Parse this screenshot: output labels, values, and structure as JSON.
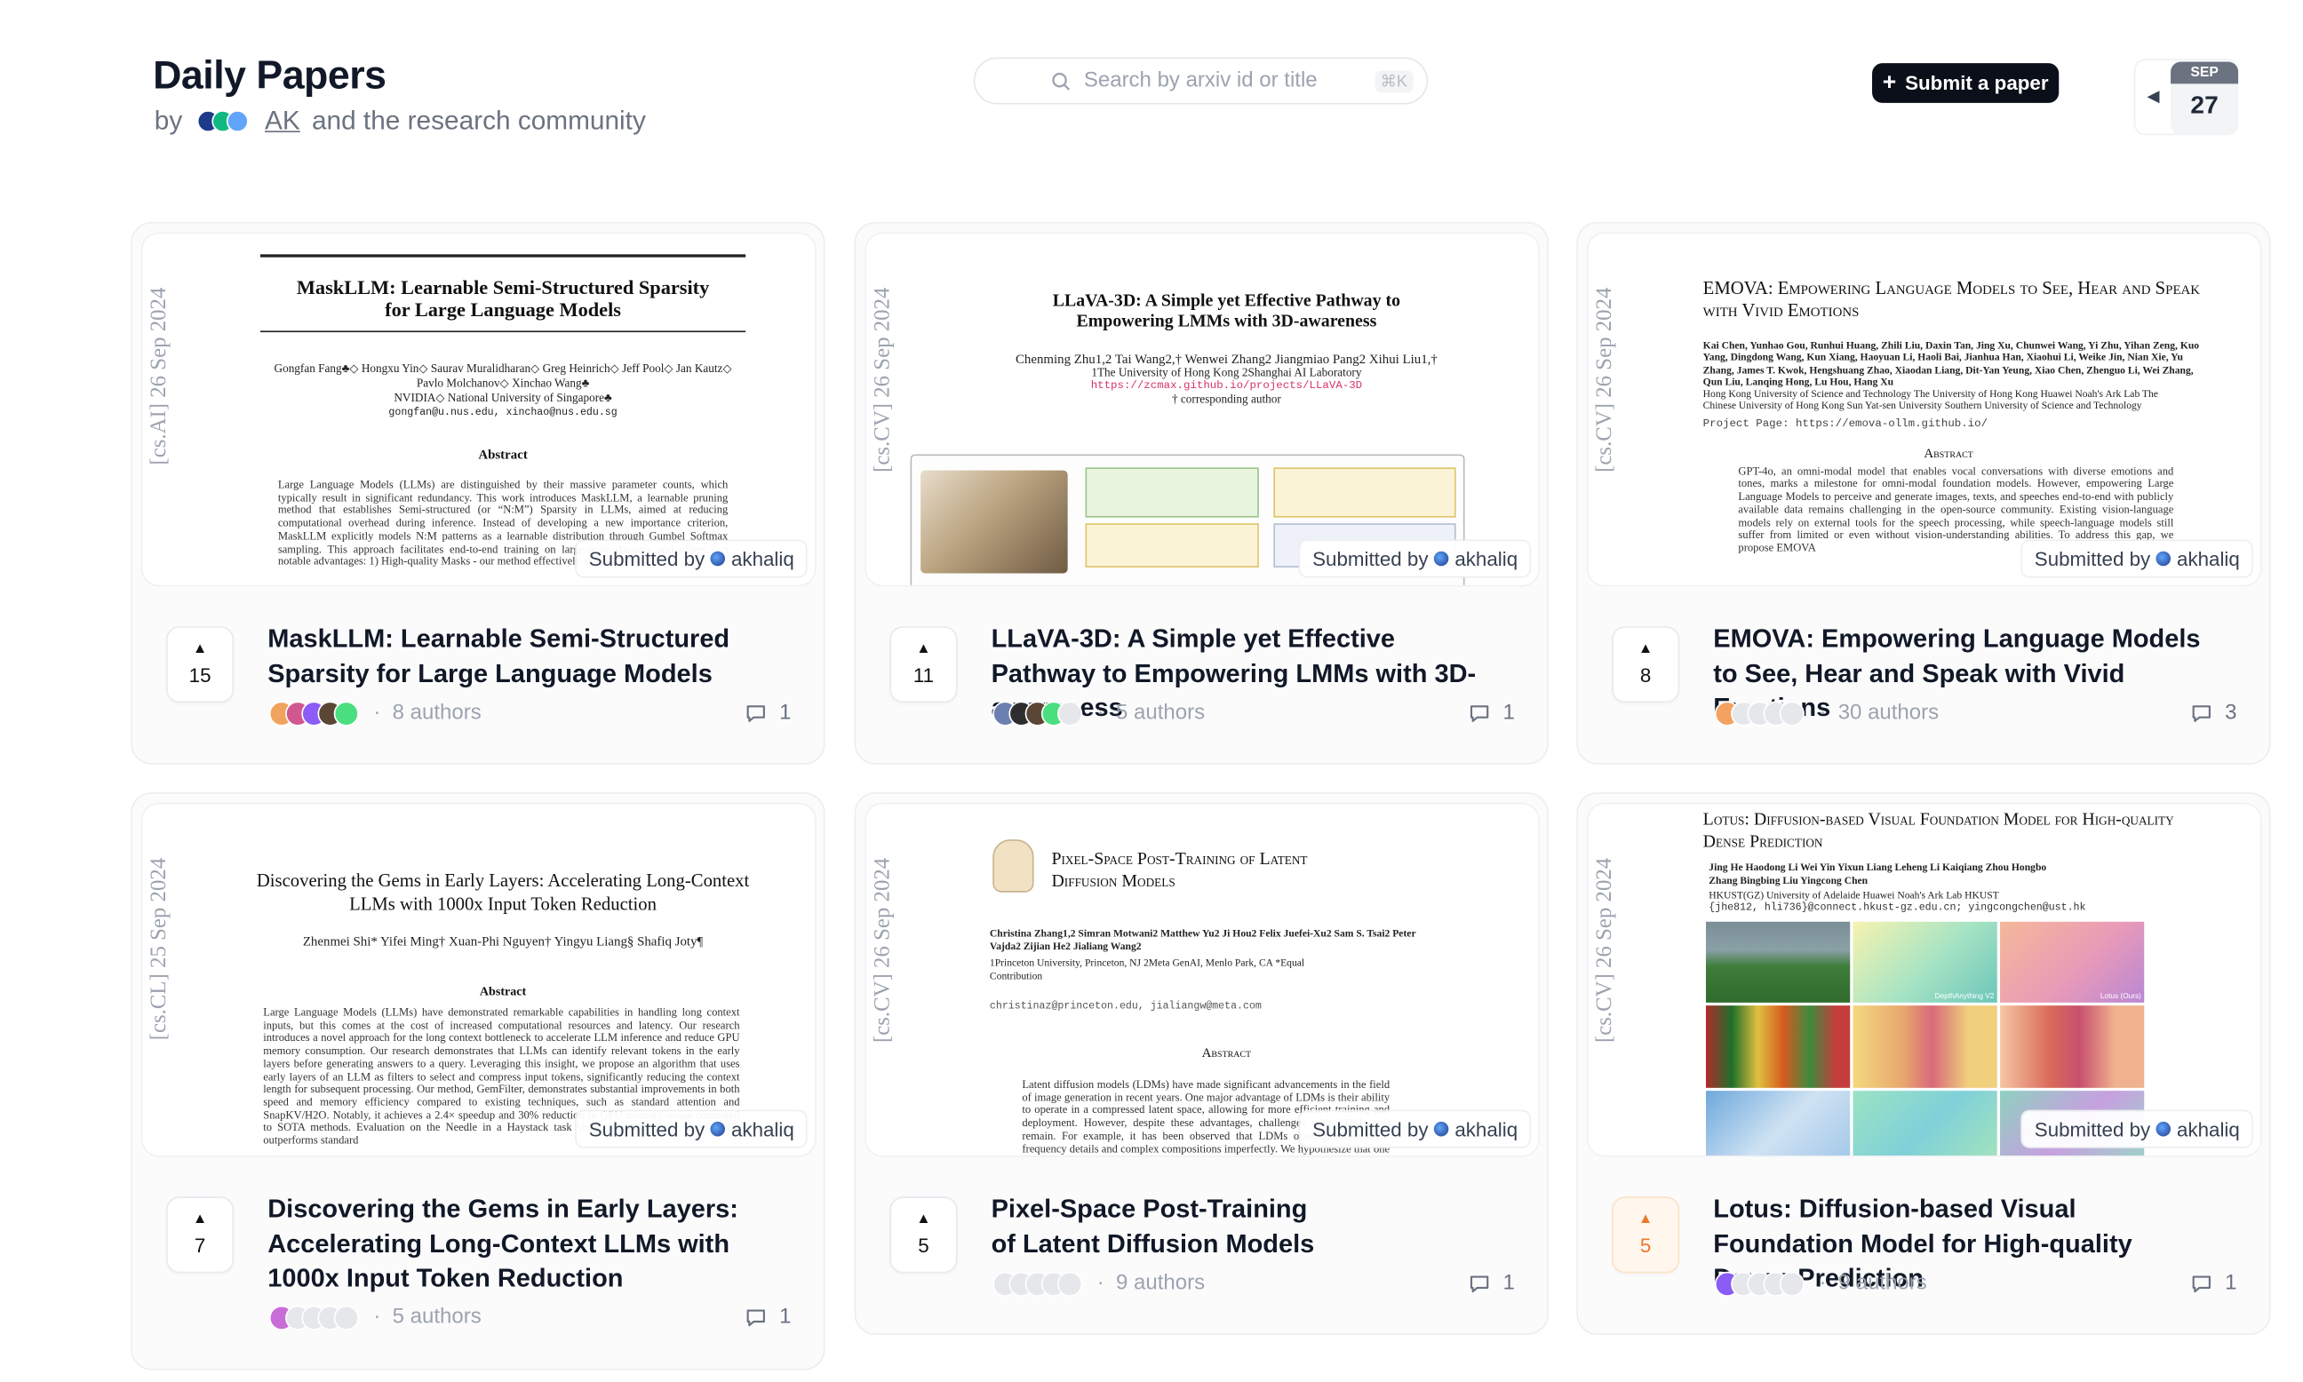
{
  "header": {
    "title": "Daily Papers",
    "by": "by",
    "author": "AK",
    "rest": "and the research community",
    "search_placeholder": "Search by arxiv id or title",
    "search_kbd": "⌘K",
    "submit_label": "Submit a paper",
    "date_month": "SEP",
    "date_day": "27"
  },
  "papers": [
    {
      "title": "MaskLLM: Learnable Semi-Structured Sparsity for Large Language Models",
      "votes": "15",
      "authors": "8 authors",
      "comments": "1",
      "submitted": "Submitted by",
      "submitter": "akhaliq",
      "stamp": "[cs.AI]  26 Sep 2024",
      "preview_title": "MaskLLM: Learnable Semi-Structured Sparsity for Large Language Models",
      "preview_authors": "Gongfan Fang♣◇ Hongxu Yin◇ Saurav Muralidharan◇ Greg Heinrich◇ Jeff Pool◇ Jan Kautz◇ Pavlo Molchanov◇ Xinchao Wang♣",
      "preview_affil": "NVIDIA◇ National University of Singapore♣",
      "preview_mail": "gongfan@u.nus.edu, xinchao@nus.edu.sg",
      "preview_abstract_head": "Abstract",
      "preview_abstract": "Large Language Models (LLMs) are distinguished by their massive parameter counts, which typically result in significant redundancy. This work introduces MaskLLM, a learnable pruning method that establishes Semi-structured (or “N:M”) Sparsity in LLMs, aimed at reducing computational overhead during inference. Instead of developing a new importance criterion, MaskLLM explicitly models N:M patterns as a learnable distribution through Gumbel Softmax sampling. This approach facilitates end-to-end training on large-scale datasets and offers two notable advantages: 1) High-quality Masks - our method effectively scales to"
    },
    {
      "title": "LLaVA-3D: A Simple yet Effective Pathway to Empowering LMMs with 3D-awareness",
      "votes": "11",
      "authors": "5 authors",
      "comments": "1",
      "submitted": "Submitted by",
      "submitter": "akhaliq",
      "stamp": "[cs.CV]  26 Sep 2024",
      "preview_title": "LLaVA-3D: A Simple yet Effective Pathway to Empowering LMMs with 3D-awareness",
      "preview_authors": "Chenming Zhu1,2  Tai Wang2,†  Wenwei Zhang2  Jiangmiao Pang2  Xihui Liu1,†",
      "preview_affil": "1The University of Hong Kong  2Shanghai AI Laboratory",
      "preview_url": "https://zcmax.github.io/projects/LLaVA-3D",
      "preview_note": "† corresponding author"
    },
    {
      "title": "EMOVA: Empowering Language Models to See, Hear and Speak with Vivid Emotions",
      "votes": "8",
      "authors": "30 authors",
      "comments": "3",
      "submitted": "Submitted by",
      "submitter": "akhaliq",
      "stamp": "[cs.CV]  26 Sep 2024",
      "preview_title": "EMOVA: Empowering Language Models to See, Hear and Speak with Vivid Emotions",
      "preview_authors": "Kai Chen, Yunhao Gou, Runhui Huang, Zhili Liu, Daxin Tan, Jing Xu, Chunwei Wang, Yi Zhu, Yihan Zeng, Kuo Yang, Dingdong Wang, Kun Xiang, Haoyuan Li, Haoli Bai, Jianhua Han, Xiaohui Li, Weike Jin, Nian Xie, Yu Zhang, James T. Kwok, Hengshuang Zhao, Xiaodan Liang, Dit-Yan Yeung, Xiao Chen, Zhenguo Li, Wei Zhang, Qun Liu, Lanqing Hong, Lu Hou, Hang Xu",
      "preview_affil": "Hong Kong University of Science and Technology  The University of Hong Kong  Huawei Noah's Ark Lab  The Chinese University of Hong Kong  Sun Yat-sen University  Southern University of Science and Technology",
      "preview_url": "Project Page: https://emova-ollm.github.io/",
      "preview_abstract_head": "Abstract",
      "preview_abstract": "GPT-4o, an omni-modal model that enables vocal conversations with diverse emotions and tones, marks a milestone for omni-modal foundation models. However, empowering Large Language Models to perceive and generate images, texts, and speeches end-to-end with publicly available data remains challenging in the open-source community. Existing vision-language models rely on external tools for the speech processing, while speech-language models still suffer from limited or even without vision-understanding abilities. To address this gap, we propose EMOVA"
    },
    {
      "title": "Discovering the Gems in Early Layers: Accelerating Long-Context LLMs with 1000x Input Token Reduction",
      "votes": "7",
      "authors": "5 authors",
      "comments": "1",
      "submitted": "Submitted by",
      "submitter": "akhaliq",
      "stamp": "[cs.CL]  25 Sep 2024",
      "preview_title": "Discovering the Gems in Early Layers: Accelerating Long-Context LLMs with 1000x Input Token Reduction",
      "preview_authors": "Zhenmei Shi*   Yifei Ming†   Xuan-Phi Nguyen†   Yingyu Liang§   Shafiq Joty¶",
      "preview_abstract_head": "Abstract",
      "preview_abstract": "Large Language Models (LLMs) have demonstrated remarkable capabilities in handling long context inputs, but this comes at the cost of increased computational resources and latency. Our research introduces a novel approach for the long context bottleneck to accelerate LLM inference and reduce GPU memory consumption. Our research demonstrates that LLMs can identify relevant tokens in the early layers before generating answers to a query. Leveraging this insight, we propose an algorithm that uses early layers of an LLM as filters to select and compress input tokens, significantly reducing the context length for subsequent processing. Our method, GemFilter, demonstrates substantial improvements in both speed and memory efficiency compared to existing techniques, such as standard attention and SnapKV/H2O. Notably, it achieves a 2.4× speedup and 30% reduction in GPU memory usage compared to SOTA methods. Evaluation on the Needle in a Haystack task shows that GemFilter significantly outperforms standard"
    },
    {
      "title": "Pixel-Space Post-Training of Latent Diffusion Models",
      "votes": "5",
      "authors": "9 authors",
      "comments": "1",
      "submitted": "Submitted by",
      "submitter": "akhaliq",
      "stamp": "[cs.CV]  26 Sep 2024",
      "preview_title": "Pixel-Space Post-Training of Latent Diffusion Models",
      "preview_authors": "Christina Zhang1,2  Simran Motwani2  Matthew Yu2  Ji Hou2  Felix Juefei-Xu2  Sam S. Tsai2  Peter Vajda2  Zijian He2  Jialiang Wang2",
      "preview_affil": "1Princeton University, Princeton, NJ  2Meta GenAI, Menlo Park, CA  *Equal Contribution",
      "preview_url": "christinaz@princeton.edu, jialiangw@meta.com",
      "preview_abstract_head": "Abstract",
      "preview_abstract": "Latent diffusion models (LDMs) have made significant advancements in the field of image generation in recent years. One major advantage of LDMs is their ability to operate in a compressed latent space, allowing for more efficient training and deployment. However, despite these advantages, challenges with LDMs still remain. For example, it has been observed that LDMs often generate high-frequency details and complex compositions imperfectly. We hypothesize that one reason for these flaws is due to the fact that all pre- and post-training of LDMs are done"
    },
    {
      "title": "Lotus: Diffusion-based Visual Foundation Model for High-quality Dense Prediction",
      "votes": "5",
      "authors": "9 authors",
      "comments": "1",
      "submitted": "Submitted by",
      "submitter": "akhaliq",
      "stamp": "[cs.CV]  26 Sep 2024",
      "preview_title": "Lotus: Diffusion-based Visual Foundation Model for High-quality Dense Prediction",
      "preview_authors": "Jing He  Haodong Li  Wei Yin  Yixun Liang  Leheng Li  Kaiqiang Zhou  Hongbo Zhang  Bingbing Liu  Yingcong Chen",
      "preview_affil": "HKUST(GZ)  University of Adelaide  Huawei Noah's Ark Lab  HKUST",
      "preview_url": "{jhe812, hli736}@connect.hkust-gz.edu.cn; yingcongchen@ust.hk",
      "preview_labels": [
        "DepthAnything V2",
        "Lotus (Ours)"
      ]
    }
  ],
  "colors": {
    "accent_dark": "#0b0f19",
    "upvote_orange": "#ea7a2b",
    "link_pink": "#d6336c"
  }
}
